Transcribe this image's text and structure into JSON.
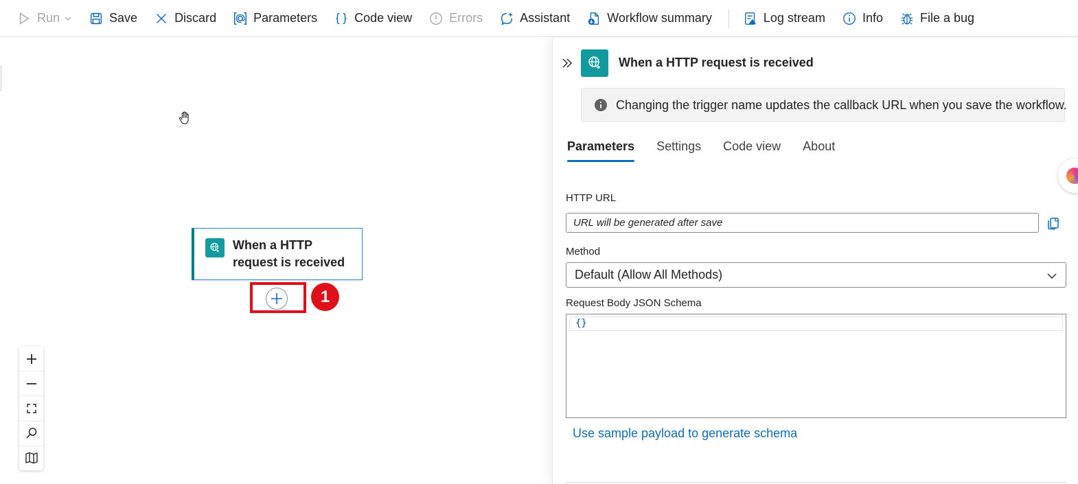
{
  "toolbar": {
    "run": "Run",
    "save": "Save",
    "discard": "Discard",
    "parameters": "Parameters",
    "code_view": "Code view",
    "errors": "Errors",
    "assistant": "Assistant",
    "workflow_summary": "Workflow summary",
    "log_stream": "Log stream",
    "info": "Info",
    "file_bug": "File a bug"
  },
  "canvas": {
    "node_title": "When a HTTP request is received",
    "badge_number": "1"
  },
  "panel": {
    "title": "When a HTTP request is received",
    "info_message": "Changing the trigger name updates the callback URL when you save the workflow.",
    "tabs": [
      {
        "label": "Parameters",
        "active": true
      },
      {
        "label": "Settings",
        "active": false
      },
      {
        "label": "Code view",
        "active": false
      },
      {
        "label": "About",
        "active": false
      }
    ],
    "http_url_label": "HTTP URL",
    "http_url_value": "URL will be generated after save",
    "method_label": "Method",
    "method_value": "Default (Allow All Methods)",
    "schema_label": "Request Body JSON Schema",
    "schema_value": "{}",
    "sample_link": "Use sample payload to generate schema"
  },
  "colors": {
    "accent": "#0f6cbd",
    "trigger_icon": "#119aa0",
    "highlight": "#e0101a"
  }
}
